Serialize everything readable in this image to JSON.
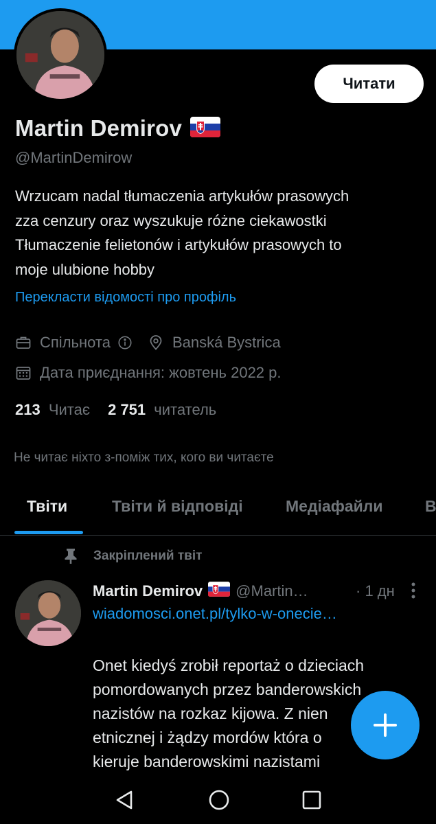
{
  "colors": {
    "accent": "#1d9bf0",
    "background": "#000000",
    "text_primary": "#e7e9ea",
    "text_secondary": "#71767b"
  },
  "profile": {
    "follow_button": "Читати",
    "display_name": "Martin Demirov",
    "flag_icon": "slovakia-flag-icon",
    "handle": "@MartinDemirow",
    "bio_lines": [
      "Wrzucam nadal tłumaczenia artykułów prasowych",
      "zza cenzury oraz wyszukuje różne ciekawostki",
      "Tłumaczenie felietonów i artykułów prasowych to",
      "moje ulubione hobby"
    ],
    "translate_link": "Перекласти відомості про профіль",
    "category": "Спільнота",
    "location": "Banská Bystrica",
    "joined": "Дата приєднання: жовтень 2022 р.",
    "following_count": "213",
    "following_label": "Читає",
    "followers_count": "2 751",
    "followers_label": "читатель",
    "not_followed_note": "Не читає ніхто з-поміж тих, кого ви читаєте"
  },
  "tabs": [
    {
      "label": "Твіти",
      "active": true
    },
    {
      "label": "Твіти й відповіді",
      "active": false
    },
    {
      "label": "Медіафайли",
      "active": false
    },
    {
      "label": "В",
      "active": false
    }
  ],
  "pinned_tweet": {
    "pinned_label": "Закріплений твіт",
    "author_name": "Martin Demirov",
    "author_handle": "@Martin…",
    "time": "· 1 дн",
    "link": "wiadomosci.onet.pl/tylko-w-onecie…",
    "text_lines": [
      "Onet kiedyś zrobił reportaż o dzieciach",
      "pomordowanych przez banderowskich",
      "nazistów na rozkaz kijowa. Z nien",
      "etnicznej i żądzy mordów która o",
      "kieruje banderowskimi nazistami"
    ]
  },
  "fab_icon": "compose-plus-icon",
  "nav_icons": [
    "back-triangle-icon",
    "home-circle-icon",
    "recents-square-icon"
  ]
}
